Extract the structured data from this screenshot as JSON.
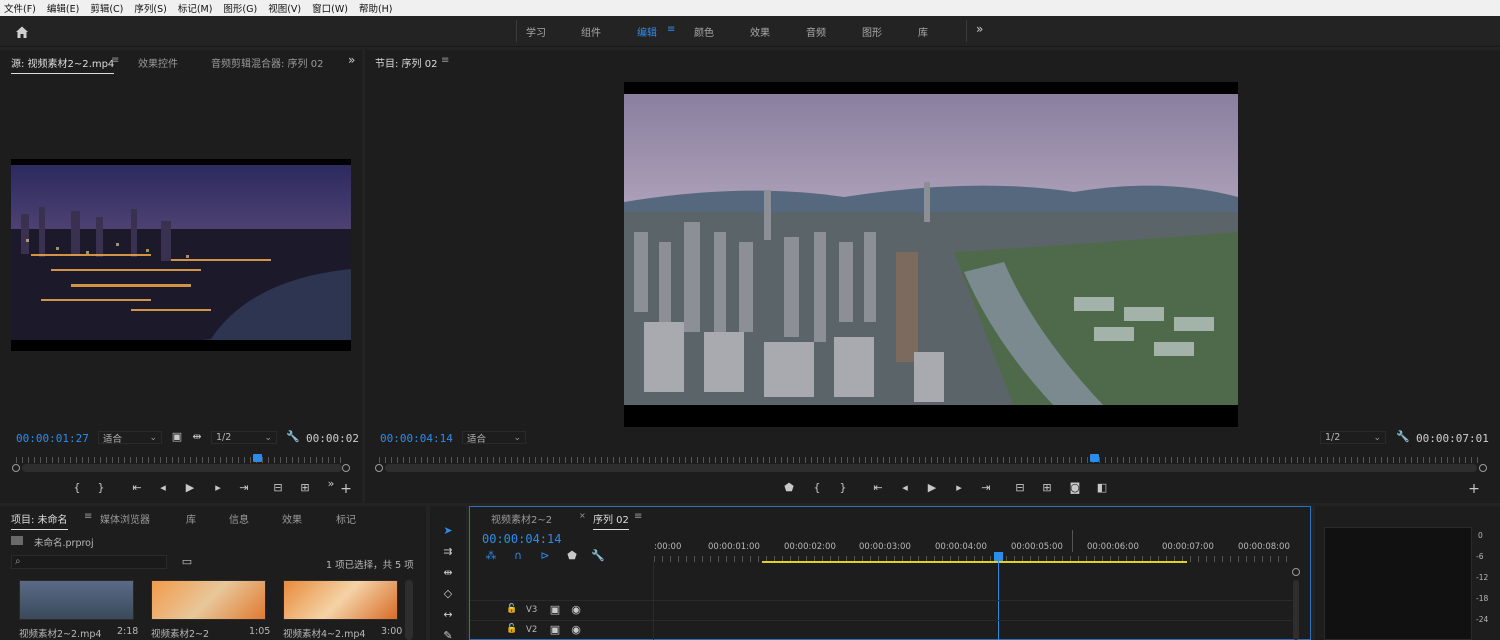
{
  "menu": [
    "文件(F)",
    "编辑(E)",
    "剪辑(C)",
    "序列(S)",
    "标记(M)",
    "图形(G)",
    "视图(V)",
    "窗口(W)",
    "帮助(H)"
  ],
  "workspaces": [
    "学习",
    "组件",
    "编辑",
    "颜色",
    "效果",
    "音频",
    "图形",
    "库"
  ],
  "active_workspace": "编辑",
  "source_panel": {
    "tabs": [
      "源: 视频素材2~2.mp4",
      "效果控件",
      "音频剪辑混合器: 序列 02"
    ],
    "timecode_left": "00:00:01:27",
    "fit": "适合",
    "resolution": "1/2",
    "timecode_right": "00:00:02",
    "playhead_fraction": 0.73
  },
  "program_panel": {
    "tab": "节目: 序列 02",
    "timecode_left": "00:00:04:14",
    "fit": "适合",
    "resolution": "1/2",
    "timecode_right": "00:00:07:01",
    "playhead_fraction": 0.65
  },
  "project_panel": {
    "tabs": [
      "项目: 未命名",
      "媒体浏览器",
      "库",
      "信息",
      "效果",
      "标记"
    ],
    "file": "未命名.prproj",
    "selection_status": "1 项已选择，共 5 项",
    "items": [
      {
        "name": "视频素材2~2.mp4",
        "duration": "2:18"
      },
      {
        "name": "视频素材2~2",
        "duration": "1:05"
      },
      {
        "name": "视频素材4~2.mp4",
        "duration": "3:00"
      }
    ]
  },
  "timeline": {
    "tabs": [
      "视频素材2~2",
      "序列 02"
    ],
    "timecode": "00:00:04:14",
    "ruler": [
      ":00:00",
      "00:00:01:00",
      "00:00:02:00",
      "00:00:03:00",
      "00:00:04:00",
      "00:00:05:00",
      "00:00:06:00",
      "00:00:07:00",
      "00:00:08:00"
    ],
    "tracks": [
      "V3",
      "V2"
    ]
  },
  "meter": {
    "scale": [
      "0",
      "-6",
      "-12",
      "-18",
      "-24"
    ]
  },
  "colors": {
    "accent": "#2d8ceb",
    "panel": "#1d1d1d",
    "work_area": "#e0d21c"
  }
}
